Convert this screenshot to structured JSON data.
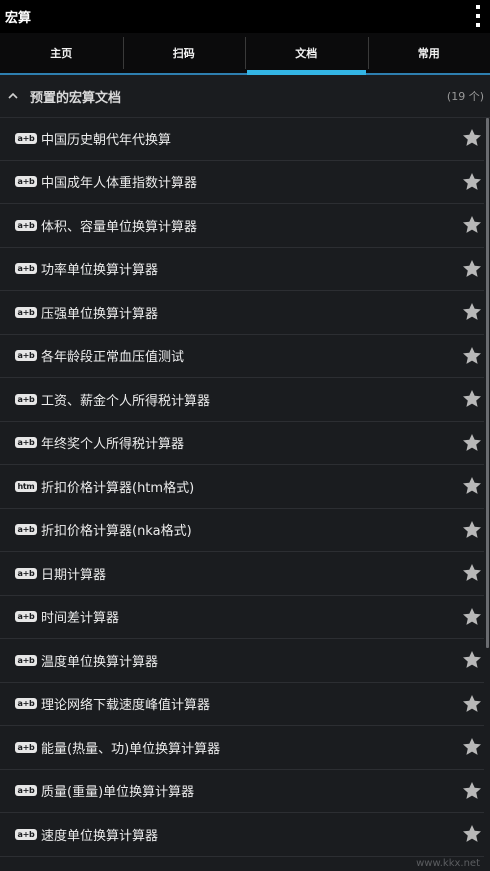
{
  "app": {
    "title": "宏算"
  },
  "tabs": [
    {
      "label": "主页"
    },
    {
      "label": "扫码"
    },
    {
      "label": "文档"
    },
    {
      "label": "常用"
    }
  ],
  "section": {
    "title": "预置的宏算文档",
    "count": "(19 个)"
  },
  "items": [
    {
      "badge": "a+b",
      "label": "中国历史朝代年代换算"
    },
    {
      "badge": "a+b",
      "label": "中国成年人体重指数计算器"
    },
    {
      "badge": "a+b",
      "label": "体积、容量单位换算计算器"
    },
    {
      "badge": "a+b",
      "label": "功率单位换算计算器"
    },
    {
      "badge": "a+b",
      "label": "压强单位换算计算器"
    },
    {
      "badge": "a+b",
      "label": "各年龄段正常血压值测试"
    },
    {
      "badge": "a+b",
      "label": "工资、薪金个人所得税计算器"
    },
    {
      "badge": "a+b",
      "label": "年终奖个人所得税计算器"
    },
    {
      "badge": "htm",
      "label": "折扣价格计算器(htm格式)"
    },
    {
      "badge": "a+b",
      "label": "折扣价格计算器(nka格式)"
    },
    {
      "badge": "a+b",
      "label": "日期计算器"
    },
    {
      "badge": "a+b",
      "label": "时间差计算器"
    },
    {
      "badge": "a+b",
      "label": "温度单位换算计算器"
    },
    {
      "badge": "a+b",
      "label": "理论网络下载速度峰值计算器"
    },
    {
      "badge": "a+b",
      "label": "能量(热量、功)单位换算计算器"
    },
    {
      "badge": "a+b",
      "label": "质量(重量)单位换算计算器"
    },
    {
      "badge": "a+b",
      "label": "速度单位换算计算器"
    }
  ],
  "watermark": "www.kkx.net",
  "colors": {
    "accent": "#33b5e5",
    "star": "#b8b8b8",
    "background": "#1a1c1f"
  }
}
